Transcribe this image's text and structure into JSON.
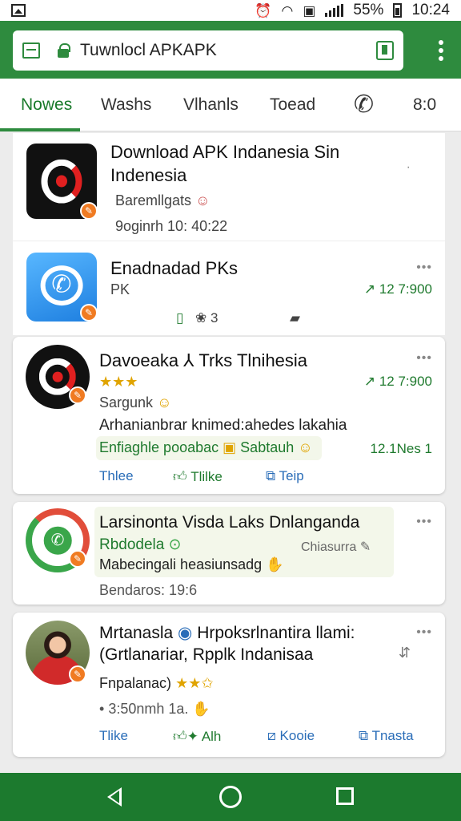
{
  "status_bar": {
    "battery": "55%",
    "time": "10:24"
  },
  "url_bar": {
    "address": "Tuwnlocl APKAPK"
  },
  "tabs": [
    {
      "label": "Nowes",
      "active": true
    },
    {
      "label": "Washs"
    },
    {
      "label": "Vlhanls"
    },
    {
      "label": "Toead"
    },
    {
      "label": "8:0"
    }
  ],
  "feed": [
    {
      "title_line1": "Download APK Indanesia Sin",
      "title_line2": "Indenesia",
      "subtitle": "Baremllgats",
      "meta": "9oginrh 10: 40:22"
    },
    {
      "title": "Enadnadad PKs",
      "subtitle": "PK",
      "stat": "12 7:900",
      "stat_sym": "↗",
      "action": "3"
    },
    {
      "title": "Davoeaka ⅄ Trks Tlnihesia",
      "rating": "★★★",
      "subtitle": "Sargunk",
      "stat1": "12 7:900",
      "stat1_sym": "↗",
      "description": "Arhanianbrar knimed:ahedes lakahia",
      "tags": "Enfiaghle pooabac",
      "tags2": "Sabtauh",
      "stat2": "12.1Nes 1",
      "actions": [
        "Thlee",
        "Tlilke",
        "Teip"
      ]
    },
    {
      "title": "Larsinonta Visda Laks Dnlanganda",
      "subtitle": "Rbdodela",
      "meta_right": "Chiasurra",
      "description": "Mabecingali heasiunsadg",
      "date": "Bendaros: 19:6"
    },
    {
      "title_line1": "Mrtanasla",
      "title_line1b": "Hrpoksrlnantira llami:",
      "title_line2": "(Grtlanariar, Rpplk Indanisaa",
      "subtitle": "Fnpalanac)",
      "rating": "★★✩",
      "meta": "3:50nmh 1a.",
      "actions": [
        "Tlike",
        "Alh",
        "Kooie",
        "Tnasta"
      ]
    }
  ],
  "colors": {
    "accent": "#2e8b3e",
    "link": "#2a6db8"
  }
}
